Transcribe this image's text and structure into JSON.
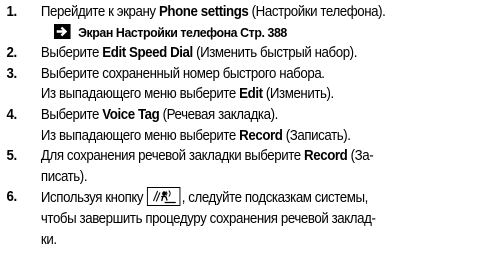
{
  "steps": [
    {
      "num": "1.",
      "line1": {
        "pre": "Перейдите к экрану ",
        "bold": "Phone settings",
        "post": " (Настройки телефона)."
      },
      "xref": {
        "bold": "Экран Настройки телефона",
        "post": " Стр. 388"
      }
    },
    {
      "num": "2.",
      "line1": {
        "pre": "Выберите ",
        "bold": "Edit Speed Dial",
        "post": " (Изменить быстрый набор)."
      }
    },
    {
      "num": "3.",
      "line1": "Выберите сохраненный номер быстрого набора.",
      "line2": {
        "pre": "Из выпадающего меню выберите ",
        "bold": "Edit",
        "post": " (Изменить)."
      }
    },
    {
      "num": "4.",
      "line1": {
        "pre": "Выберите ",
        "bold": "Voice Tag",
        "post": " (Речевая закладка)."
      },
      "line2": {
        "pre": "Из выпадающего меню выберите ",
        "bold": "Record",
        "post": " (Записать)."
      }
    },
    {
      "num": "5.",
      "line1": {
        "pre": "Для сохранения речевой закладки выберите ",
        "bold": "Record",
        "post": " (За-"
      },
      "line2": "писать)."
    },
    {
      "num": "6.",
      "line1": {
        "pre": "Используя кнопку ",
        "post": ", следуйте подсказкам системы,"
      },
      "line2": "чтобы завершить процедуру сохранения речевой заклад-",
      "line3": "ки."
    }
  ],
  "icons": {
    "xref_arrow": "arrow-right-icon",
    "voice_button": "voice-command-icon"
  }
}
